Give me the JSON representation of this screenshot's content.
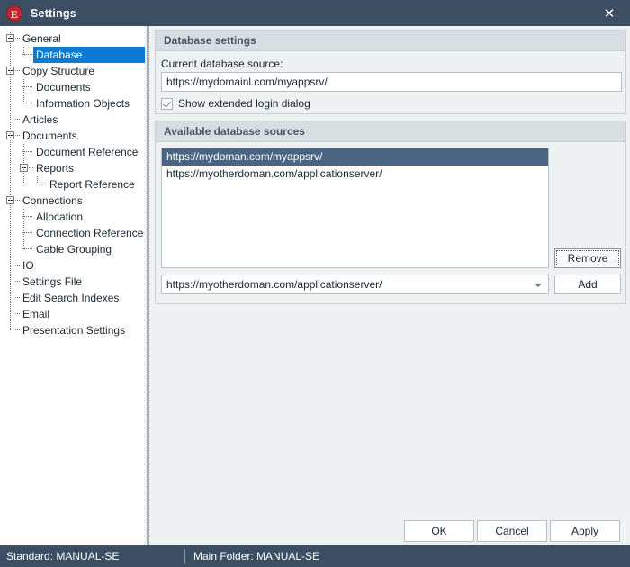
{
  "window": {
    "title": "Settings",
    "icon": "app-logo-icon",
    "icon_letter": "E",
    "close_label": "✕",
    "accent_titlebar": "#3b4e63",
    "accent_selection": "#0b7ad4",
    "accent_list_selection": "#4a6484"
  },
  "tree": {
    "items": [
      {
        "label": "General",
        "level": 0,
        "expander": "minus",
        "selected": false
      },
      {
        "label": "Database",
        "level": 1,
        "expander": "none",
        "selected": true
      },
      {
        "label": "Copy Structure",
        "level": 0,
        "expander": "minus",
        "selected": false
      },
      {
        "label": "Documents",
        "level": 1,
        "expander": "none",
        "selected": false
      },
      {
        "label": "Information Objects",
        "level": 1,
        "expander": "none",
        "selected": false
      },
      {
        "label": "Articles",
        "level": 0,
        "expander": "none",
        "selected": false
      },
      {
        "label": "Documents",
        "level": 0,
        "expander": "minus",
        "selected": false
      },
      {
        "label": "Document Reference",
        "level": 1,
        "expander": "none",
        "selected": false
      },
      {
        "label": "Reports",
        "level": 1,
        "expander": "minus",
        "selected": false
      },
      {
        "label": "Report Reference",
        "level": 2,
        "expander": "none",
        "selected": false
      },
      {
        "label": "Connections",
        "level": 0,
        "expander": "minus",
        "selected": false
      },
      {
        "label": "Allocation",
        "level": 1,
        "expander": "none",
        "selected": false
      },
      {
        "label": "Connection Reference",
        "level": 1,
        "expander": "none",
        "selected": false
      },
      {
        "label": "Cable Grouping",
        "level": 1,
        "expander": "none",
        "selected": false
      },
      {
        "label": "IO",
        "level": 0,
        "expander": "none",
        "selected": false
      },
      {
        "label": "Settings File",
        "level": 0,
        "expander": "none",
        "selected": false
      },
      {
        "label": "Edit Search Indexes",
        "level": 0,
        "expander": "none",
        "selected": false
      },
      {
        "label": "Email",
        "level": 0,
        "expander": "none",
        "selected": false
      },
      {
        "label": "Presentation Settings",
        "level": 0,
        "expander": "none",
        "selected": false
      }
    ]
  },
  "database_settings": {
    "group_title": "Database settings",
    "current_source_label": "Current database source:",
    "current_source_value": "https://mydomainl.com/myappsrv/",
    "show_extended_login_label": "Show extended login dialog",
    "show_extended_login_checked": true
  },
  "available_sources": {
    "group_title": "Available database sources",
    "items": [
      {
        "value": "https://mydoman.com/myappsrv/",
        "selected": true
      },
      {
        "value": "https://myotherdoman.com/applicationserver/",
        "selected": false
      }
    ],
    "remove_label": "Remove",
    "add_label": "Add",
    "combo_value": "https://myotherdoman.com/applicationserver/"
  },
  "dialog_buttons": {
    "ok": "OK",
    "cancel": "Cancel",
    "apply": "Apply"
  },
  "statusbar": {
    "left": "Standard: MANUAL-SE",
    "right": "Main Folder: MANUAL-SE"
  }
}
